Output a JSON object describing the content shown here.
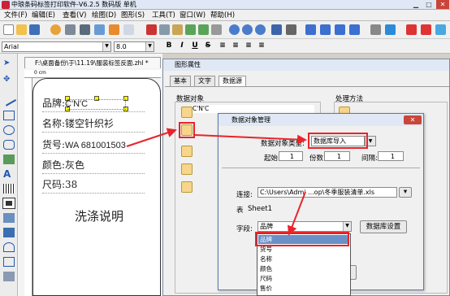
{
  "window": {
    "title": "中琅条码标签打印软件-V6.2.5 数码版 单机"
  },
  "menu": [
    "文件(F)",
    "编辑(E)",
    "查看(V)",
    "绘图(D)",
    "图形(S)",
    "工具(T)",
    "窗口(W)",
    "帮助(H)"
  ],
  "font": {
    "family": "Arial",
    "size": "8.0"
  },
  "document": {
    "tab_title": "F:\\桌面备份\\于\\11.19\\服装标签反面.zhl *",
    "ruler_label": "0 cm"
  },
  "label_fields": [
    "品牌:",
    "名称:镂空针织衫",
    "货号:",
    "颜色:灰色",
    "尺码:38"
  ],
  "label_values": {
    "brand": "C'N'C",
    "code": "WA 681001503"
  },
  "label_footer": "洗涤说明",
  "props": {
    "title": "图形属性",
    "tabs": [
      "基本",
      "文字",
      "数据源"
    ],
    "data_objects_label": "数据对象",
    "processing_label": "处理方法",
    "data_item": "C'N'C"
  },
  "dialog": {
    "title": "数据对象管理",
    "type_label": "数据对象类型:",
    "type_value": "数据库导入",
    "start_label": "起始:",
    "start_value": "1",
    "copies_label": "份数:",
    "copies_value": "1",
    "interval_label": "间隔:",
    "interval_value": "1",
    "connect_label": "连接:",
    "connect_value": "C:\\Users\\Admi ...op\\冬季服装清单.xls",
    "table_label": "表",
    "table_value": "Sheet1",
    "field_label": "字段:",
    "field_value": "品牌",
    "db_settings_button": "数据库设置"
  },
  "dropdown_items": [
    "品牌",
    "货号",
    "名称",
    "颜色",
    "尺码",
    "售价"
  ],
  "colors": {
    "accent": "#e8242a",
    "selected": "#6b8fc7"
  }
}
